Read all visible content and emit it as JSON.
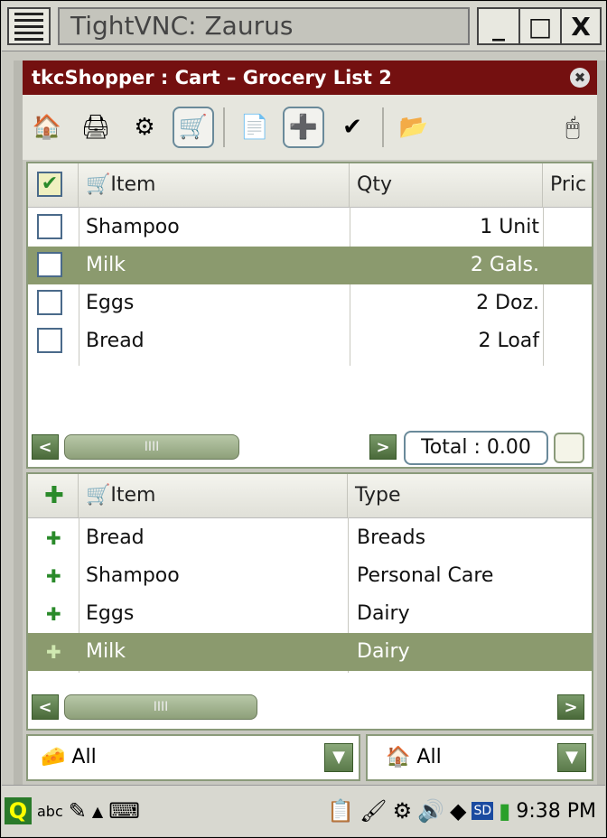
{
  "vnc": {
    "title": "TightVNC: Zaurus",
    "minimize": "_",
    "maximize": "□",
    "close": "X"
  },
  "app": {
    "title": "tkcShopper : Cart – Grocery List 2",
    "close_glyph": "✖"
  },
  "toolbar": {
    "icons": [
      "home-icon",
      "print-icon",
      "settings-icon",
      "cart-icon",
      "new-document-icon",
      "cart-add-icon",
      "cart-check-icon",
      "open-folder-icon",
      "mouse-icon"
    ]
  },
  "cart": {
    "headers": {
      "item": "Item",
      "qty": "Qty",
      "price": "Pric"
    },
    "rows": [
      {
        "item": "Shampoo",
        "qty": "1 Unit",
        "selected": false
      },
      {
        "item": "Milk",
        "qty": "2 Gals.",
        "selected": true
      },
      {
        "item": "Eggs",
        "qty": "2 Doz.",
        "selected": false
      },
      {
        "item": "Bread",
        "qty": "2 Loaf",
        "selected": false
      }
    ],
    "total": "Total : 0.00",
    "scroll_thumb": "IIII"
  },
  "items": {
    "headers": {
      "item": "Item",
      "type": "Type"
    },
    "rows": [
      {
        "item": "Bread",
        "type": "Breads",
        "selected": false
      },
      {
        "item": "Shampoo",
        "type": "Personal Care",
        "selected": false
      },
      {
        "item": "Eggs",
        "type": "Dairy",
        "selected": false
      },
      {
        "item": "Milk",
        "type": "Dairy",
        "selected": true
      }
    ],
    "scroll_thumb": "IIII"
  },
  "filters": {
    "left": "All",
    "right": "All"
  },
  "taskbar": {
    "input_mode": "abc",
    "time": "9:38 PM"
  },
  "colors": {
    "title_bar": "#741010",
    "selection": "#8b9a6e",
    "accent_green": "#2a8a2a"
  }
}
